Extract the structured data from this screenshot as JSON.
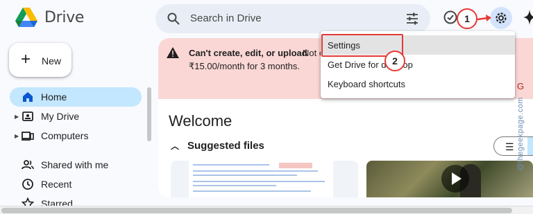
{
  "app": {
    "name": "Drive"
  },
  "search": {
    "placeholder": "Search in Drive"
  },
  "new_button": {
    "label": "New"
  },
  "sidebar": {
    "items": [
      {
        "label": "Home",
        "icon": "home-icon",
        "active": true
      },
      {
        "label": "My Drive",
        "icon": "my-drive-icon"
      },
      {
        "label": "Computers",
        "icon": "computers-icon"
      },
      {
        "label": "Shared with me",
        "icon": "people-icon"
      },
      {
        "label": "Recent",
        "icon": "clock-icon"
      },
      {
        "label": "Starred",
        "icon": "star-icon"
      }
    ]
  },
  "banner": {
    "title_bold": "Can't create, edit, or upload",
    "title_rest": "Not e",
    "line2": "₹15.00/month for 3 months.",
    "clipped_action": "G"
  },
  "main": {
    "welcome": "Welcome",
    "suggested_files": "Suggested files"
  },
  "settings_menu": {
    "items": [
      {
        "label": "Settings"
      },
      {
        "label": "Get Drive for desktop"
      },
      {
        "label": "Keyboard shortcuts"
      }
    ]
  },
  "callouts": {
    "one": "1",
    "two": "2"
  },
  "watermark": "@thegeekpage.com",
  "colors": {
    "accent": "#c2e7ff",
    "banner": "#fad7d5",
    "callout_border": "#e53935",
    "search_bg": "#e9eef6"
  }
}
